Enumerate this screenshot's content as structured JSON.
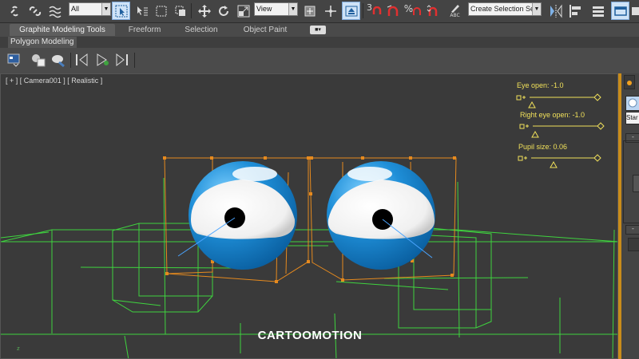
{
  "toolbar": {
    "selection_filter": "All",
    "reference_coord_system": "View",
    "named_selection_placeholder": "Create Selection Se",
    "snap_toggle": "3",
    "snap_percent": "%",
    "spinner_snap_label": "ABC",
    "icons": [
      "link-icon",
      "unlink-icon",
      "bind-spacewarp-icon",
      "select-object-icon",
      "select-by-name-icon",
      "rect-region-icon",
      "window-crossing-icon",
      "move-icon",
      "rotate-icon",
      "scale-icon",
      "pivot-icon",
      "select-manipulate-icon",
      "keyboard-shortcut-icon",
      "snap-icon",
      "angle-snap-icon",
      "percent-snap-icon",
      "spinner-snap-icon",
      "edit-named-sets-icon",
      "mirror-icon",
      "align-icon",
      "layer-manager-icon",
      "ribbon-toggle-icon"
    ]
  },
  "ribbon": {
    "tabs": [
      "Graphite Modeling Tools",
      "Freeform",
      "Selection",
      "Object Paint"
    ],
    "active_tab": "Graphite Modeling Tools",
    "panel_tab": "Polygon Modeling"
  },
  "viewport": {
    "label": "[ + ] [ Camera001 ] [ Realistic ]",
    "watermark": "CARTOOMOTION",
    "axis": "z"
  },
  "controls": {
    "eye_open": {
      "label": "Eye open: -1.0",
      "value": -1.0
    },
    "right_eye_open": {
      "label": "Right eye open: -1.0",
      "value": -1.0
    },
    "pupil_size": {
      "label": "Pupil size: 0.06",
      "value": 0.06
    }
  },
  "command_panel": {
    "tab_text": "Star"
  },
  "colors": {
    "eye_blue": "#1f8fd8",
    "gizmo_green": "#3fd33f",
    "bbox_orange": "#e68a1e",
    "ctrl_yellow": "#f0e05a"
  }
}
